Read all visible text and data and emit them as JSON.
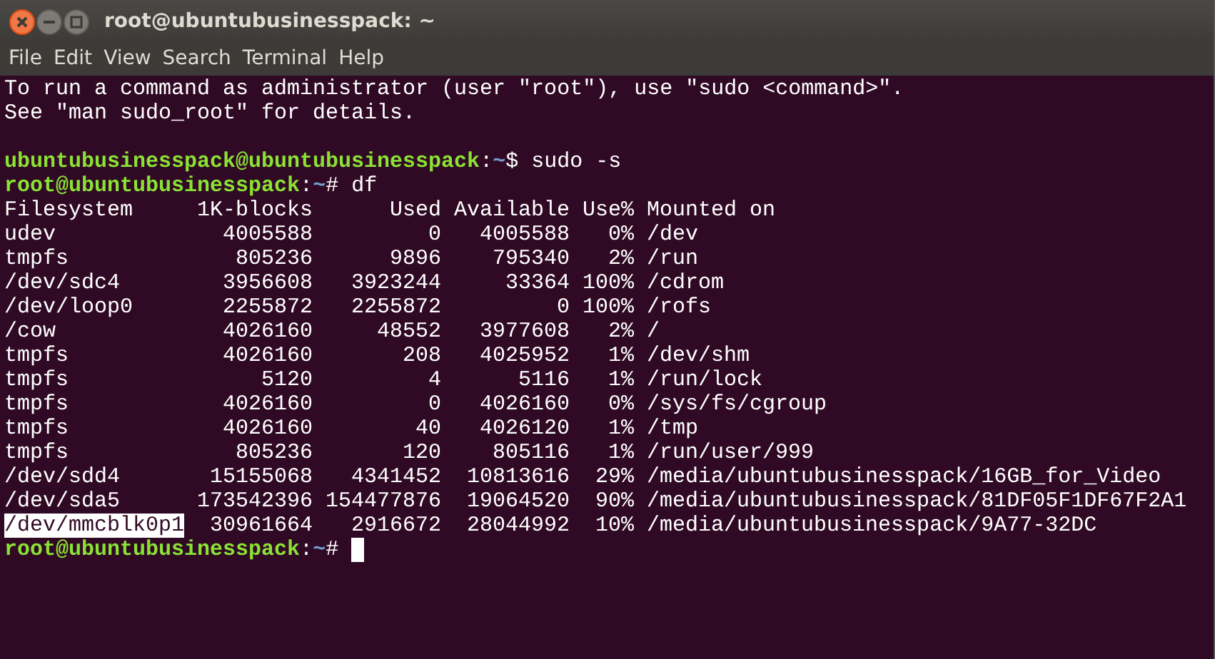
{
  "window": {
    "title": "root@ubuntubusinesspack: ~"
  },
  "menu": [
    "File",
    "Edit",
    "View",
    "Search",
    "Terminal",
    "Help"
  ],
  "terminal": {
    "lines": [
      {
        "kind": "text",
        "text": "To run a command as administrator (user \"root\"), use \"sudo <command>\"."
      },
      {
        "kind": "text",
        "text": "See \"man sudo_root\" for details."
      },
      {
        "kind": "blank"
      },
      {
        "kind": "prompt",
        "user_host": "ubuntubusinesspack@ubuntubusinesspack",
        "separator": ":",
        "path": "~",
        "symbol": "$",
        "command": "sudo -s",
        "cursor": false
      },
      {
        "kind": "prompt",
        "user_host": "root@ubuntubusinesspack",
        "separator": ":",
        "path": "~",
        "symbol": "#",
        "command": "df",
        "cursor": false
      },
      {
        "kind": "table",
        "columns": [
          "Filesystem",
          "1K-blocks",
          "Used",
          "Available",
          "Use%",
          "Mounted on"
        ],
        "rows": [
          {
            "filesystem": "udev",
            "blocks": "4005588",
            "used": "0",
            "available": "4005588",
            "use_pct": "0%",
            "mounted_on": "/dev",
            "highlighted": false
          },
          {
            "filesystem": "tmpfs",
            "blocks": "805236",
            "used": "9896",
            "available": "795340",
            "use_pct": "2%",
            "mounted_on": "/run",
            "highlighted": false
          },
          {
            "filesystem": "/dev/sdc4",
            "blocks": "3956608",
            "used": "3923244",
            "available": "33364",
            "use_pct": "100%",
            "mounted_on": "/cdrom",
            "highlighted": false
          },
          {
            "filesystem": "/dev/loop0",
            "blocks": "2255872",
            "used": "2255872",
            "available": "0",
            "use_pct": "100%",
            "mounted_on": "/rofs",
            "highlighted": false
          },
          {
            "filesystem": "/cow",
            "blocks": "4026160",
            "used": "48552",
            "available": "3977608",
            "use_pct": "2%",
            "mounted_on": "/",
            "highlighted": false
          },
          {
            "filesystem": "tmpfs",
            "blocks": "4026160",
            "used": "208",
            "available": "4025952",
            "use_pct": "1%",
            "mounted_on": "/dev/shm",
            "highlighted": false
          },
          {
            "filesystem": "tmpfs",
            "blocks": "5120",
            "used": "4",
            "available": "5116",
            "use_pct": "1%",
            "mounted_on": "/run/lock",
            "highlighted": false
          },
          {
            "filesystem": "tmpfs",
            "blocks": "4026160",
            "used": "0",
            "available": "4026160",
            "use_pct": "0%",
            "mounted_on": "/sys/fs/cgroup",
            "highlighted": false
          },
          {
            "filesystem": "tmpfs",
            "blocks": "4026160",
            "used": "40",
            "available": "4026120",
            "use_pct": "1%",
            "mounted_on": "/tmp",
            "highlighted": false
          },
          {
            "filesystem": "tmpfs",
            "blocks": "805236",
            "used": "120",
            "available": "805116",
            "use_pct": "1%",
            "mounted_on": "/run/user/999",
            "highlighted": false
          },
          {
            "filesystem": "/dev/sdd4",
            "blocks": "15155068",
            "used": "4341452",
            "available": "10813616",
            "use_pct": "29%",
            "mounted_on": "/media/ubuntubusinesspack/16GB_for_Video",
            "highlighted": false
          },
          {
            "filesystem": "/dev/sda5",
            "blocks": "173542396",
            "used": "154477876",
            "available": "19064520",
            "use_pct": "90%",
            "mounted_on": "/media/ubuntubusinesspack/81DF05F1DF67F2A1",
            "highlighted": false
          },
          {
            "filesystem": "/dev/mmcblk0p1",
            "blocks": "30961664",
            "used": "2916672",
            "available": "28044992",
            "use_pct": "10%",
            "mounted_on": "/media/ubuntubusinesspack/9A77-32DC",
            "highlighted": true
          }
        ]
      },
      {
        "kind": "prompt",
        "user_host": "root@ubuntubusinesspack",
        "separator": ":",
        "path": "~",
        "symbol": "#",
        "cursor": true
      }
    ]
  }
}
